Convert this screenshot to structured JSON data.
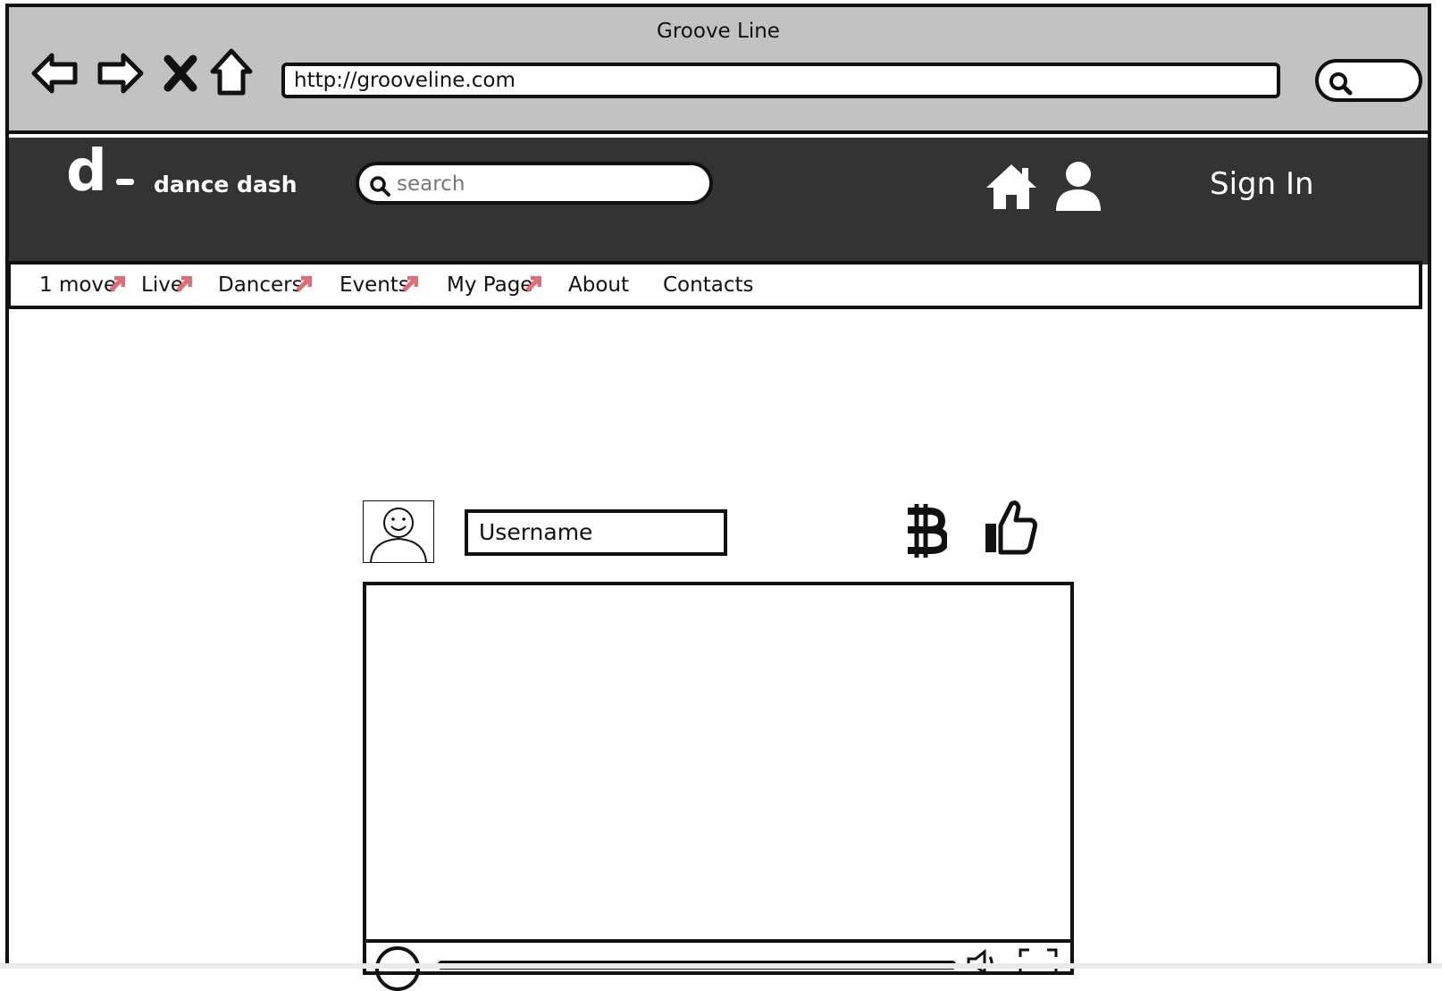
{
  "browser": {
    "window_title": "Groove Line",
    "url": "http://grooveline.com",
    "icons": [
      "back-arrow-icon",
      "forward-arrow-icon",
      "close-x-icon",
      "home-outline-icon",
      "search-icon"
    ]
  },
  "header": {
    "logo_letter": "d",
    "logo_text": "dance dash",
    "search_placeholder": "search",
    "icons": [
      "home-icon",
      "user-icon"
    ],
    "sign_in": "Sign In",
    "background": "#333333"
  },
  "menu": {
    "items": [
      {
        "label": "1 move",
        "external": true
      },
      {
        "label": "Live",
        "external": true
      },
      {
        "label": "Dancers",
        "external": true
      },
      {
        "label": "Events",
        "external": true
      },
      {
        "label": "My Page",
        "external": true
      },
      {
        "label": "About",
        "external": false
      },
      {
        "label": "Contacts",
        "external": false
      }
    ]
  },
  "post": {
    "username": "Username",
    "icons": [
      "avatar-icon",
      "bitcoin-icon",
      "thumbs-up-icon",
      "play-icon",
      "volume-icon",
      "fullscreen-icon"
    ]
  },
  "colors": {
    "chrome_bg": "#c2c2c2",
    "header_bg": "#333333",
    "external_link_marker": "#e06c75"
  }
}
